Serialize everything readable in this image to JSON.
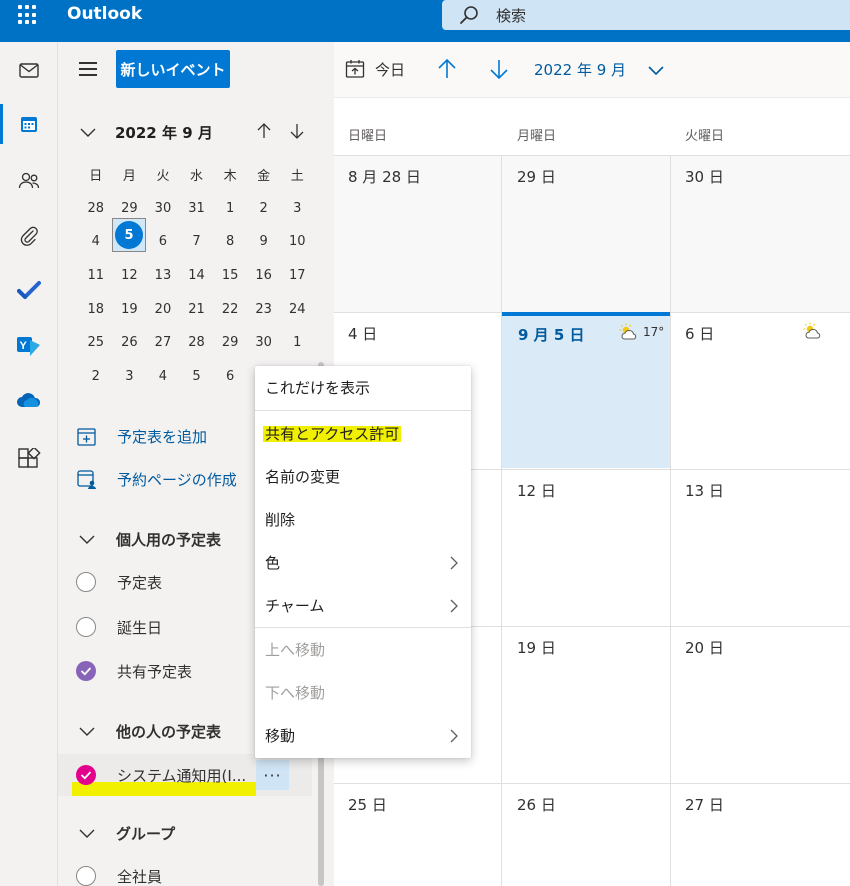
{
  "header": {
    "app_title": "Outlook",
    "search_placeholder": "検索"
  },
  "rail": {
    "items": [
      "mail-icon",
      "calendar-icon",
      "people-icon",
      "attach-icon",
      "todo-icon",
      "yammer-icon",
      "onedrive-icon",
      "apps-icon"
    ]
  },
  "nav": {
    "new_event_label": "新しいイベント",
    "mini_calendar": {
      "title": "2022 年 9 月",
      "weekdays": [
        "日",
        "月",
        "火",
        "水",
        "木",
        "金",
        "土"
      ],
      "weeks": [
        [
          "28",
          "29",
          "30",
          "31",
          "1",
          "2",
          "3"
        ],
        [
          "4",
          "5",
          "6",
          "7",
          "8",
          "9",
          "10"
        ],
        [
          "11",
          "12",
          "13",
          "14",
          "15",
          "16",
          "17"
        ],
        [
          "18",
          "19",
          "20",
          "21",
          "22",
          "23",
          "24"
        ],
        [
          "25",
          "26",
          "27",
          "28",
          "29",
          "30",
          "1"
        ],
        [
          "2",
          "3",
          "4",
          "5",
          "6",
          "",
          ""
        ]
      ],
      "today": "5"
    },
    "add_calendar_label": "予定表を追加",
    "booking_page_label": "予約ページの作成",
    "personal_section_label": "個人用の予定表",
    "personal_calendars": [
      {
        "label": "予定表",
        "checked": false
      },
      {
        "label": "誕生日",
        "checked": false
      },
      {
        "label": "共有予定表",
        "checked": true,
        "color": "#8764b8"
      }
    ],
    "others_section_label": "他の人の予定表",
    "others_calendars": [
      {
        "label": "システム通知用(I...",
        "checked": true,
        "color": "#e3008c"
      }
    ],
    "more_button_label": "···",
    "group_section_label": "グループ",
    "group_calendars": [
      {
        "label": "全社員",
        "checked": false
      }
    ]
  },
  "toolbar": {
    "today_label": "今日",
    "month_label": "2022 年 9 月"
  },
  "calendar": {
    "weekdays": [
      "日曜日",
      "月曜日",
      "火曜日"
    ],
    "rows": [
      [
        "8 月 28 日",
        "29 日",
        "30 日"
      ],
      [
        "4 日",
        "9 月 5 日",
        "6 日"
      ],
      [
        "",
        "12 日",
        "13 日"
      ],
      [
        "",
        "19 日",
        "20 日"
      ],
      [
        "25 日",
        "26 日",
        "27 日"
      ]
    ],
    "today_weather_temp": "17°"
  },
  "context_menu": {
    "items": [
      {
        "label": "これだけを表示",
        "disabled": false,
        "submenu": false
      },
      {
        "label": "共有とアクセス許可",
        "disabled": false,
        "submenu": false,
        "highlight": true
      },
      {
        "label": "名前の変更",
        "disabled": false,
        "submenu": false
      },
      {
        "label": "削除",
        "disabled": false,
        "submenu": false
      },
      {
        "label": "色",
        "disabled": false,
        "submenu": true
      },
      {
        "label": "チャーム",
        "disabled": false,
        "submenu": true
      },
      {
        "label": "上へ移動",
        "disabled": true,
        "submenu": false
      },
      {
        "label": "下へ移動",
        "disabled": true,
        "submenu": false
      },
      {
        "label": "移動",
        "disabled": false,
        "submenu": true
      }
    ]
  },
  "colors": {
    "brand": "#0078d4",
    "highlight": "#f0f000",
    "today_cell": "#dbeaf7"
  }
}
